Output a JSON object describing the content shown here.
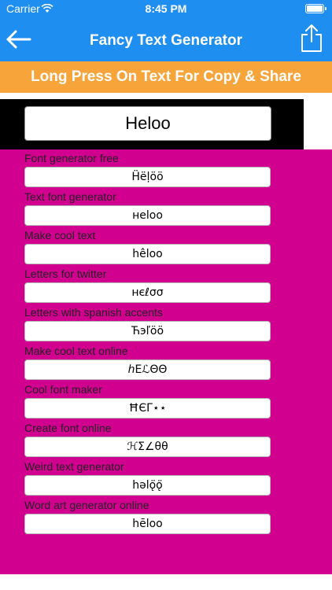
{
  "status": {
    "carrier": "Carrier",
    "time": "8:45 PM"
  },
  "nav": {
    "title": "Fancy Text Generator",
    "back_icon": "arrow-left-icon",
    "share_icon": "share-icon"
  },
  "banner": {
    "text": "Long Press On Text For Copy & Share"
  },
  "input": {
    "value": "Heloo"
  },
  "results": [
    {
      "label": "Font generator free",
      "value": "Ḧëḷöö"
    },
    {
      "label": "Text font generator",
      "value": "нeloo"
    },
    {
      "label": "Make cool text",
      "value": "hêloo"
    },
    {
      "label": "Letters for twitter",
      "value": "нєℓσσ"
    },
    {
      "label": "Letters with spanish accents",
      "value": "Ћэľöö"
    },
    {
      "label": "Make cool text online",
      "value": "ℎEℒΘΘ"
    },
    {
      "label": "Cool font maker",
      "value": "ĦЄΓ⋆⋆"
    },
    {
      "label": "Create font online",
      "value": "ℋΣ∠θθ"
    },
    {
      "label": "Weird text generator",
      "value": "hǝlǫ̈ǫ̈"
    },
    {
      "label": "Word art generator online",
      "value": "hēloo"
    }
  ],
  "colors": {
    "nav": "#1f8ef1",
    "banner": "#f7a43a",
    "results_bg": "#d1008f",
    "input_panel": "#000000"
  }
}
